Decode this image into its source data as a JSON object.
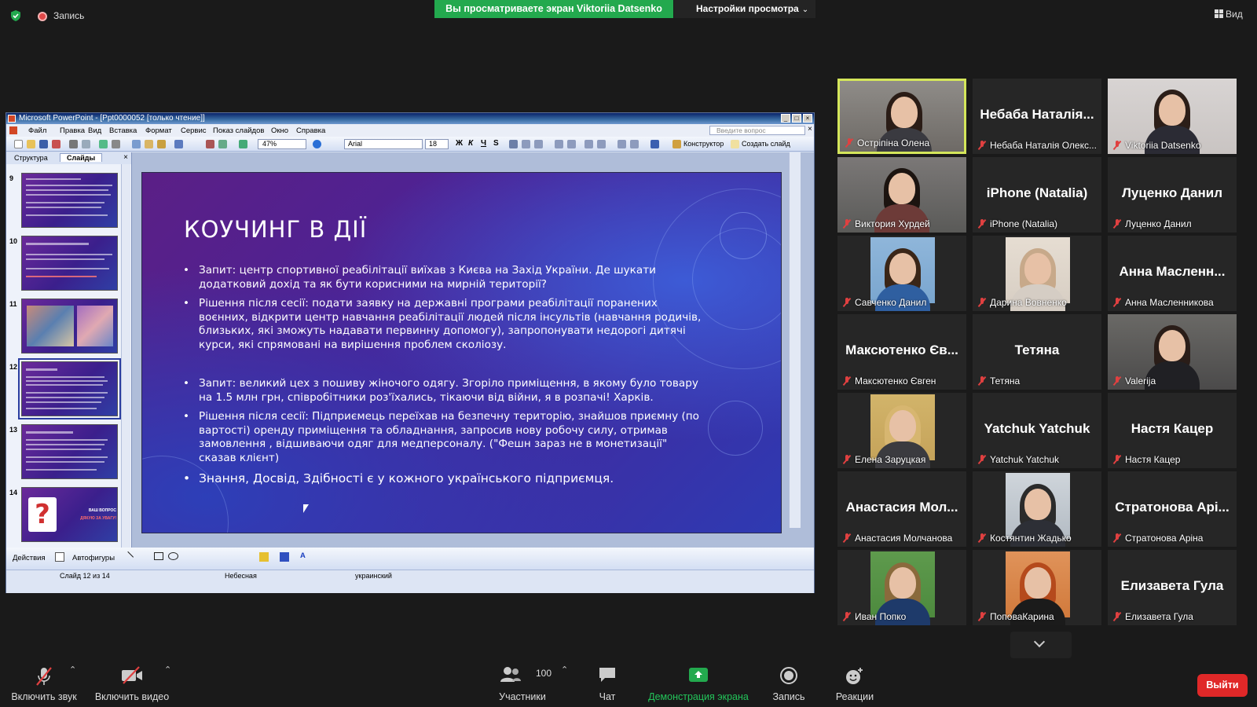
{
  "topbar": {
    "recording_label": "Запись",
    "share_banner": "Вы просматриваете экран Viktoriia Datsenko",
    "view_options": "Настройки просмотра",
    "view_button": "Вид"
  },
  "ppt": {
    "window_title": "Microsoft PowerPoint - [Ppt0000052 [только чтение]]",
    "menu": [
      "Файл",
      "Правка",
      "Вид",
      "Вставка",
      "Формат",
      "Сервис",
      "Показ слайдов",
      "Окно",
      "Справка"
    ],
    "ask_placeholder": "Введите вопрос",
    "zoom": "47%",
    "font": "Arial",
    "font_size": "18",
    "format_buttons": [
      "Ж",
      "К",
      "Ч",
      "S"
    ],
    "designer": "Конструктор",
    "new_slide": "Создать слайд",
    "pane_tabs": [
      "Структура",
      "Слайды"
    ],
    "thumbnail_numbers": [
      "9",
      "10",
      "11",
      "12",
      "13",
      "14"
    ],
    "thumb14_line1": "ВАШ ВОПРОС",
    "thumb14_line2": "ДЯКУЮ ЗА УВАГУ!",
    "slide": {
      "title": "КОУЧИНГ В ДІЇ",
      "bullets": [
        "Запит: центр спортивної реабілітації виїхав з Києва на Захід України.  Де шукати додатковий дохід та як бути корисними на мирній території?",
        "Рішення після сесії: подати заявку на державні програми реабілітації поранених воєнних, відкрити центр навчання реабілітації людей після інсультів (навчання родичів, близьких, які зможуть надавати первинну допомогу), запропонувати недорогі дитячі курси, які спрямовані на вирішення проблем сколіозу.",
        "Запит: великий цех з пошиву жіночого одягу. Згоріло приміщення, в якому було товару на 1.5 млн грн,  співробітники роз'їхались, тікаючи від війни, я в розпачі! Харків.",
        "Рішення після сесії: Підприємець переїхав на безпечну територію, знайшов приємну (по вартості) оренду приміщення та обладнання, запросив нову робочу силу, отримав замовлення , відшиваючи одяг для медперсоналу. (\"Фешн зараз не в монетизації\" сказав клієнт)",
        "Знання, Досвід, Здібності є у кожного українського підприємця."
      ]
    },
    "drawbar": {
      "actions": "Действия",
      "autoshapes": "Автофигуры"
    },
    "status": {
      "slide_of": "Слайд 12 из 14",
      "design": "Небесная",
      "language": "украинский"
    }
  },
  "participants": [
    {
      "name": "Остріпіна Олена",
      "type": "video",
      "active": true
    },
    {
      "name": "Небаба Наталія Олекс...",
      "display": "Небаба Наталія...",
      "type": "name"
    },
    {
      "name": "Viktoriia Datsenko",
      "type": "video"
    },
    {
      "name": "Виктория Хурдей",
      "type": "video"
    },
    {
      "name": "iPhone (Natalia)",
      "display": "iPhone (Natalia)",
      "type": "name"
    },
    {
      "name": "Луценко Данил",
      "display": "Луценко Данил",
      "type": "name"
    },
    {
      "name": "Савченко Данил",
      "type": "photo"
    },
    {
      "name": "Дарина Вовненко",
      "type": "photo"
    },
    {
      "name": "Анна Масленникова",
      "display": "Анна Масленн...",
      "type": "name"
    },
    {
      "name": "Максютенко Євген",
      "display": "Максютенко Єв...",
      "type": "name"
    },
    {
      "name": "Тетяна",
      "display": "Тетяна",
      "type": "name"
    },
    {
      "name": "Valerija",
      "type": "video"
    },
    {
      "name": "Елена Заруцкая",
      "type": "photo"
    },
    {
      "name": "Yatchuk Yatchuk",
      "display": "Yatchuk Yatchuk",
      "type": "name"
    },
    {
      "name": "Настя Кацер",
      "display": "Настя Кацер",
      "type": "name"
    },
    {
      "name": "Анастасия Молчанова",
      "display": "Анастасия Мол...",
      "type": "name"
    },
    {
      "name": "Костянтин Жадько",
      "type": "photo"
    },
    {
      "name": "Стратонова Аріна",
      "display": "Стратонова Арі...",
      "type": "name"
    },
    {
      "name": "Иван Попко",
      "type": "photo"
    },
    {
      "name": "ПоповаКарина",
      "type": "photo"
    },
    {
      "name": "Елизавета Гула",
      "display": "Елизавета Гула",
      "type": "name"
    }
  ],
  "bottombar": {
    "mic": "Включить звук",
    "video": "Включить видео",
    "participants": "Участники",
    "participants_count": "100",
    "chat": "Чат",
    "share": "Демонстрация экрана",
    "record": "Запись",
    "reactions": "Реакции",
    "exit": "Выйти"
  },
  "colors": {
    "share_green": "#23a94e",
    "active_speaker": "#d4e65a",
    "exit_red": "#e02828",
    "mute_red": "#e04040"
  }
}
